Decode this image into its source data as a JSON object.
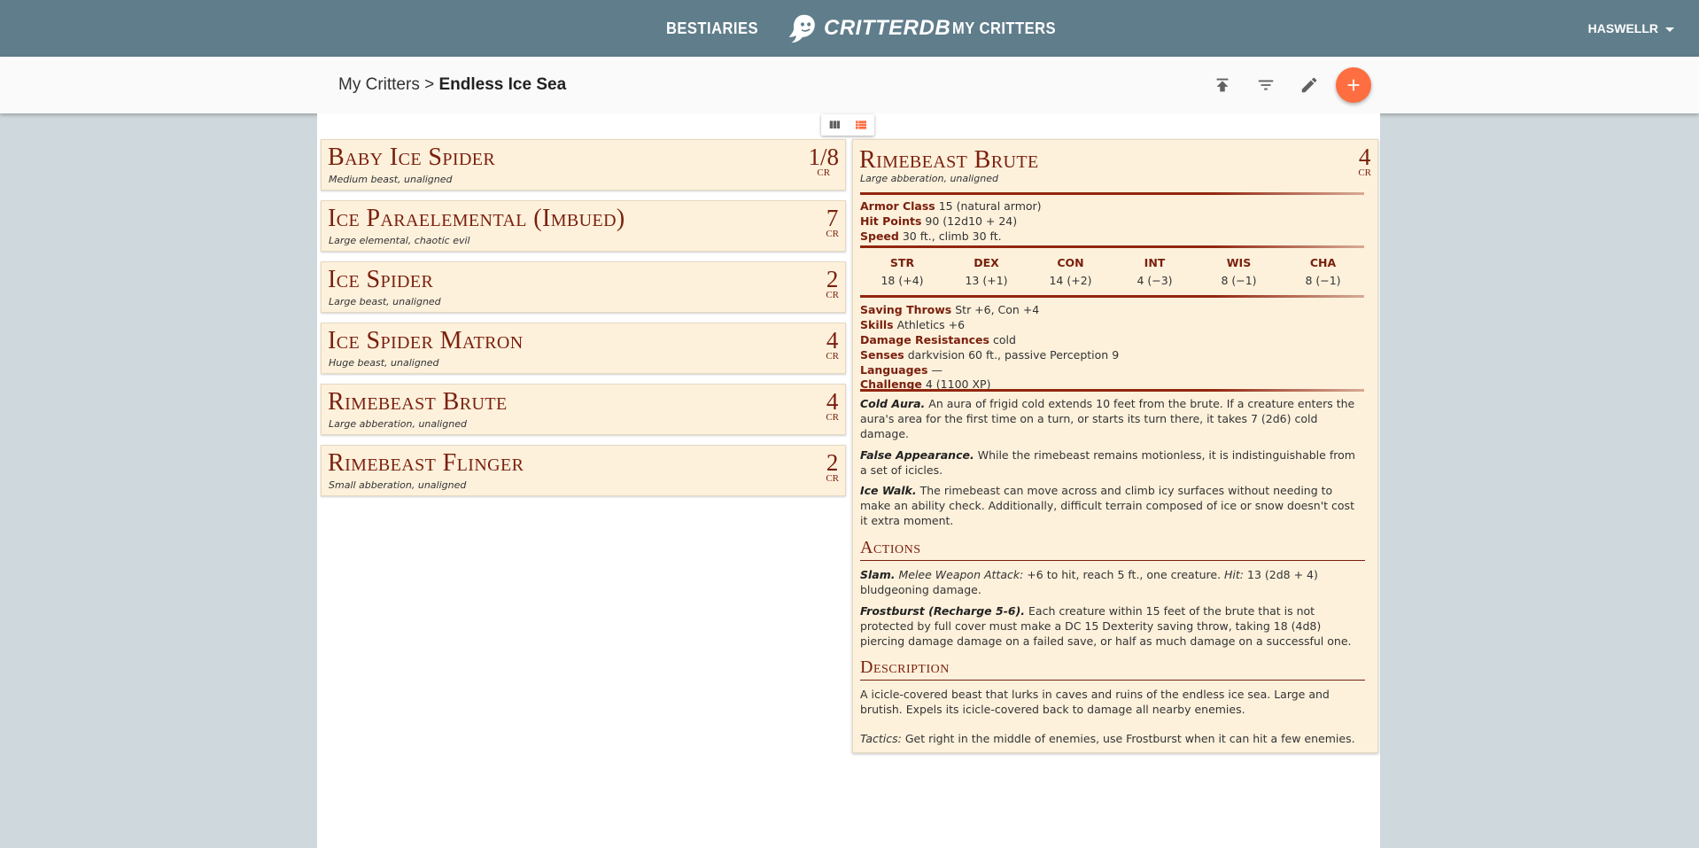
{
  "nav": {
    "bestiaries": "BESTIARIES",
    "brand": "CRITTERDB",
    "my_critters": "MY CRITTERS",
    "user": "HASWELLR"
  },
  "subheader": {
    "breadcrumb_parent": "My Critters",
    "breadcrumb_sep": ">",
    "breadcrumb_current": "Endless Ice Sea"
  },
  "critters": [
    {
      "name": "Baby Ice Spider",
      "meta": "Medium beast, unaligned",
      "cr": "1/8",
      "cr_label": "CR"
    },
    {
      "name": "Ice Paraelemental (Imbued)",
      "meta": "Large elemental, chaotic evil",
      "cr": "7",
      "cr_label": "CR"
    },
    {
      "name": "Ice Spider",
      "meta": "Large beast, unaligned",
      "cr": "2",
      "cr_label": "CR"
    },
    {
      "name": "Ice Spider Matron",
      "meta": "Huge beast, unaligned",
      "cr": "4",
      "cr_label": "CR"
    },
    {
      "name": "Rimebeast Brute",
      "meta": "Large abberation, unaligned",
      "cr": "4",
      "cr_label": "CR"
    },
    {
      "name": "Rimebeast Flinger",
      "meta": "Small abberation, unaligned",
      "cr": "2",
      "cr_label": "CR"
    }
  ],
  "statblock": {
    "name": "Rimebeast Brute",
    "meta": "Large abberation, unaligned",
    "cr": "4",
    "cr_label": "CR",
    "armor_class_label": "Armor Class",
    "armor_class": "15 (natural armor)",
    "hit_points_label": "Hit Points",
    "hit_points": "90 (12d10 + 24)",
    "speed_label": "Speed",
    "speed": "30 ft., climb 30 ft.",
    "abilities": [
      {
        "abbr": "STR",
        "score": "18 (+4)"
      },
      {
        "abbr": "DEX",
        "score": "13 (+1)"
      },
      {
        "abbr": "CON",
        "score": "14 (+2)"
      },
      {
        "abbr": "INT",
        "score": "4 (−3)"
      },
      {
        "abbr": "WIS",
        "score": "8 (−1)"
      },
      {
        "abbr": "CHA",
        "score": "8 (−1)"
      }
    ],
    "saving_throws_label": "Saving Throws",
    "saving_throws": "Str +6, Con +4",
    "skills_label": "Skills",
    "skills": "Athletics +6",
    "damage_resistances_label": "Damage Resistances",
    "damage_resistances": "cold",
    "senses_label": "Senses",
    "senses": "darkvision 60 ft., passive Perception 9",
    "languages_label": "Languages",
    "languages": "—",
    "challenge_label": "Challenge",
    "challenge": "4 (1100 XP)",
    "traits": [
      {
        "name": "Cold Aura.",
        "text": "An aura of frigid cold extends 10 feet from the brute. If a creature enters the aura's area for the first time on a turn, or starts its turn there, it takes 7 (2d6) cold damage."
      },
      {
        "name": "False Appearance.",
        "text": "While the rimebeast remains motionless, it is indistinguishable from a set of icicles."
      },
      {
        "name": "Ice Walk.",
        "text": "The rimebeast can move across and climb icy surfaces without needing to make an ability check. Additionally, difficult terrain composed of ice or snow doesn't cost it extra moment."
      }
    ],
    "actions_heading": "Actions",
    "slam_name": "Slam.",
    "slam_attack_type": "Melee Weapon Attack:",
    "slam_attack_text": "+6 to hit, reach 5 ft., one creature.",
    "slam_hit_label": "Hit:",
    "slam_hit_text": "13 (2d8 + 4) bludgeoning damage.",
    "frostburst_name": "Frostburst (Recharge 5-6).",
    "frostburst_text": "Each creature within 15 feet of the brute  that is not protected by full cover must make a DC 15 Dexterity saving throw, taking 18 (4d8) piercing damage damage on a failed save, or half as much damage on a successful one.",
    "description_heading": "Description",
    "description_text": "A icicle-covered beast that lurks in caves and ruins of the endless ice sea. Large and brutish. Expels its icicle-covered back to damage all nearby enemies.",
    "tactics_label": "Tactics:",
    "tactics_text": "Get right in the middle of enemies, use Frostburst when it can hit a few enemies."
  },
  "colors": {
    "topbar": "#607d8b",
    "accent": "#ff6e40",
    "card_bg": "#fdf1dc",
    "heading_red": "#7a200d"
  }
}
